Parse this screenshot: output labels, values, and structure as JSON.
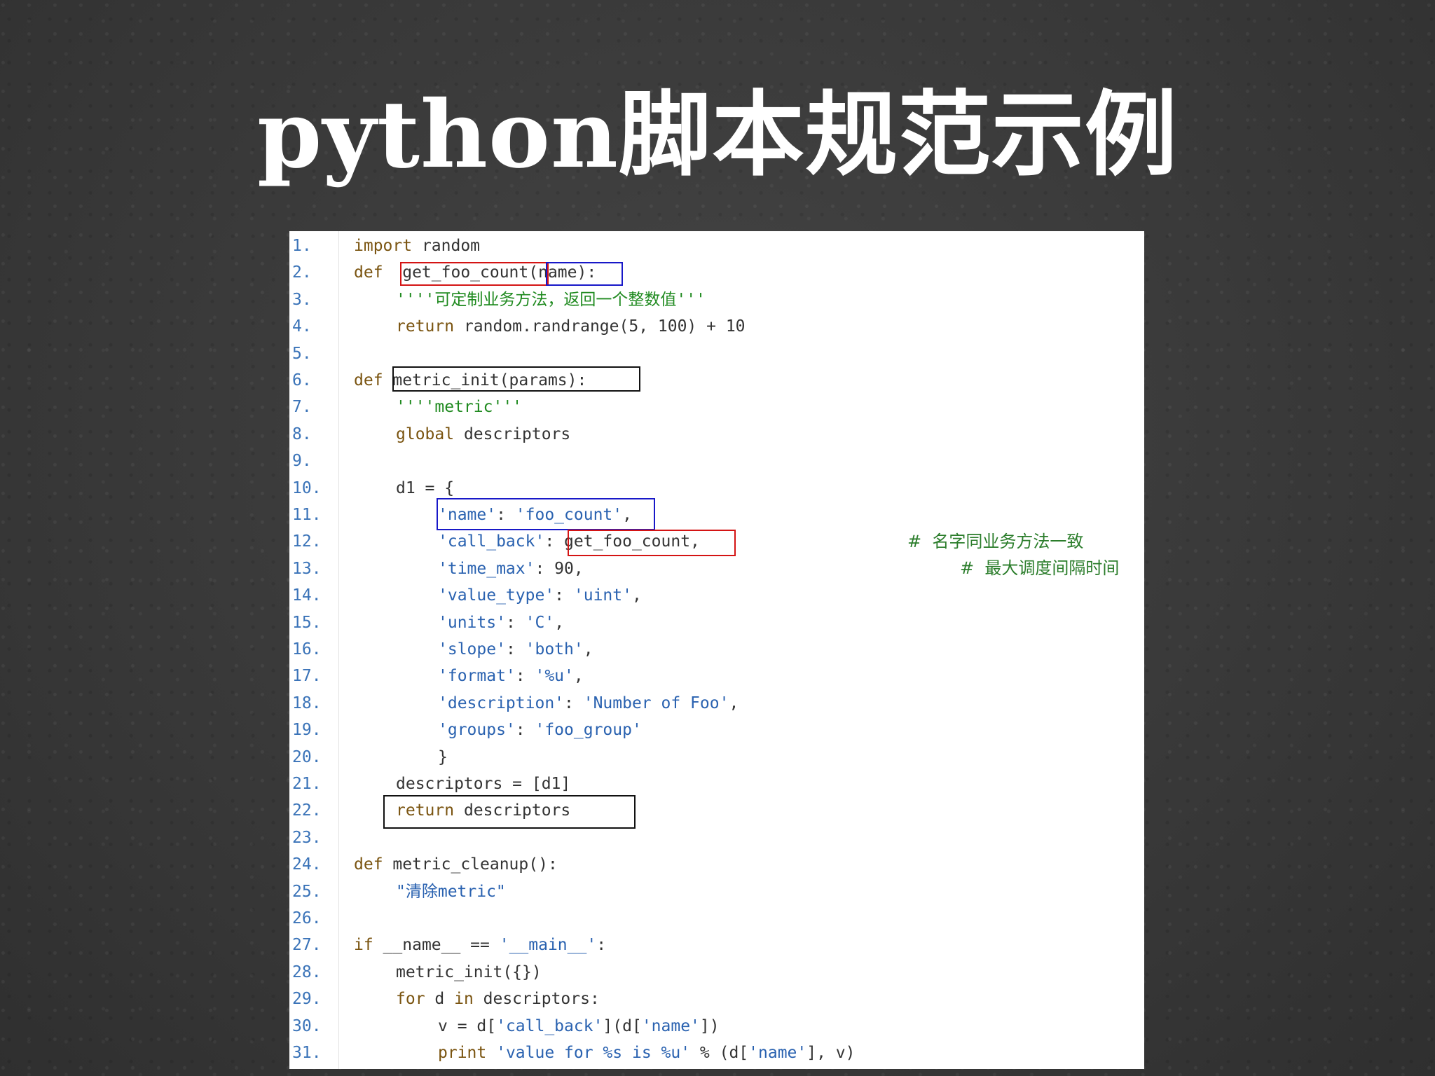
{
  "slide": {
    "title": "python脚本规范示例"
  },
  "code": {
    "lines": [
      {
        "n": "1.",
        "indent": 0,
        "tokens": [
          {
            "t": "import",
            "c": "kw"
          },
          {
            "t": " random",
            "c": "plain"
          }
        ]
      },
      {
        "n": "2.",
        "indent": 0,
        "tokens": [
          {
            "t": "def",
            "c": "kw"
          },
          {
            "t": "  get_foo_count(name):",
            "c": "plain"
          }
        ]
      },
      {
        "n": "3.",
        "indent": 1,
        "tokens": [
          {
            "t": "''''可定制业务方法，返回一个整数值'''",
            "c": "doc"
          }
        ]
      },
      {
        "n": "4.",
        "indent": 1,
        "tokens": [
          {
            "t": "return",
            "c": "kw"
          },
          {
            "t": " random.randrange(5, 100) + 10",
            "c": "plain"
          }
        ]
      },
      {
        "n": "5.",
        "indent": 0,
        "tokens": []
      },
      {
        "n": "6.",
        "indent": 0,
        "tokens": [
          {
            "t": "def",
            "c": "kw"
          },
          {
            "t": " metric_init(params):",
            "c": "plain"
          }
        ]
      },
      {
        "n": "7.",
        "indent": 1,
        "tokens": [
          {
            "t": "''''metric'''",
            "c": "doc"
          }
        ]
      },
      {
        "n": "8.",
        "indent": 1,
        "tokens": [
          {
            "t": "global",
            "c": "kw"
          },
          {
            "t": " descriptors",
            "c": "plain"
          }
        ]
      },
      {
        "n": "9.",
        "indent": 0,
        "tokens": []
      },
      {
        "n": "10.",
        "indent": 1,
        "tokens": [
          {
            "t": "d1 = {",
            "c": "plain"
          }
        ]
      },
      {
        "n": "11.",
        "indent": 2,
        "tokens": [
          {
            "t": "'name'",
            "c": "str"
          },
          {
            "t": ": ",
            "c": "plain"
          },
          {
            "t": "'foo_count'",
            "c": "str"
          },
          {
            "t": ",",
            "c": "plain"
          }
        ]
      },
      {
        "n": "12.",
        "indent": 2,
        "tokens": [
          {
            "t": "'call_back'",
            "c": "str"
          },
          {
            "t": ": get_foo_count,",
            "c": "plain"
          }
        ]
      },
      {
        "n": "13.",
        "indent": 2,
        "tokens": [
          {
            "t": "'time_max'",
            "c": "str"
          },
          {
            "t": ": 90,",
            "c": "plain"
          }
        ]
      },
      {
        "n": "14.",
        "indent": 2,
        "tokens": [
          {
            "t": "'value_type'",
            "c": "str"
          },
          {
            "t": ": ",
            "c": "plain"
          },
          {
            "t": "'uint'",
            "c": "str"
          },
          {
            "t": ",",
            "c": "plain"
          }
        ]
      },
      {
        "n": "15.",
        "indent": 2,
        "tokens": [
          {
            "t": "'units'",
            "c": "str"
          },
          {
            "t": ": ",
            "c": "plain"
          },
          {
            "t": "'C'",
            "c": "str"
          },
          {
            "t": ",",
            "c": "plain"
          }
        ]
      },
      {
        "n": "16.",
        "indent": 2,
        "tokens": [
          {
            "t": "'slope'",
            "c": "str"
          },
          {
            "t": ": ",
            "c": "plain"
          },
          {
            "t": "'both'",
            "c": "str"
          },
          {
            "t": ",",
            "c": "plain"
          }
        ]
      },
      {
        "n": "17.",
        "indent": 2,
        "tokens": [
          {
            "t": "'format'",
            "c": "str"
          },
          {
            "t": ": ",
            "c": "plain"
          },
          {
            "t": "'%u'",
            "c": "str"
          },
          {
            "t": ",",
            "c": "plain"
          }
        ]
      },
      {
        "n": "18.",
        "indent": 2,
        "tokens": [
          {
            "t": "'description'",
            "c": "str"
          },
          {
            "t": ": ",
            "c": "plain"
          },
          {
            "t": "'Number of Foo'",
            "c": "str"
          },
          {
            "t": ",",
            "c": "plain"
          }
        ]
      },
      {
        "n": "19.",
        "indent": 2,
        "tokens": [
          {
            "t": "'groups'",
            "c": "str"
          },
          {
            "t": ": ",
            "c": "plain"
          },
          {
            "t": "'foo_group'",
            "c": "str"
          }
        ]
      },
      {
        "n": "20.",
        "indent": 2,
        "tokens": [
          {
            "t": "}",
            "c": "plain"
          }
        ]
      },
      {
        "n": "21.",
        "indent": 1,
        "tokens": [
          {
            "t": "descriptors = [d1]",
            "c": "plain"
          }
        ]
      },
      {
        "n": "22.",
        "indent": 1,
        "tokens": [
          {
            "t": "return",
            "c": "kw"
          },
          {
            "t": " descriptors",
            "c": "plain"
          }
        ]
      },
      {
        "n": "23.",
        "indent": 0,
        "tokens": []
      },
      {
        "n": "24.",
        "indent": 0,
        "tokens": [
          {
            "t": "def",
            "c": "kw"
          },
          {
            "t": " metric_cleanup():",
            "c": "plain"
          }
        ]
      },
      {
        "n": "25.",
        "indent": 1,
        "tokens": [
          {
            "t": "\"清除metric\"",
            "c": "str"
          }
        ]
      },
      {
        "n": "26.",
        "indent": 0,
        "tokens": []
      },
      {
        "n": "27.",
        "indent": 0,
        "tokens": [
          {
            "t": "if",
            "c": "kw"
          },
          {
            "t": " __name__ == ",
            "c": "plain"
          },
          {
            "t": "'__main__'",
            "c": "str"
          },
          {
            "t": ":",
            "c": "plain"
          }
        ]
      },
      {
        "n": "28.",
        "indent": 1,
        "tokens": [
          {
            "t": "metric_init({})",
            "c": "plain"
          }
        ]
      },
      {
        "n": "29.",
        "indent": 1,
        "tokens": [
          {
            "t": "for",
            "c": "kw"
          },
          {
            "t": " d ",
            "c": "plain"
          },
          {
            "t": "in",
            "c": "kw"
          },
          {
            "t": " descriptors:",
            "c": "plain"
          }
        ]
      },
      {
        "n": "30.",
        "indent": 2,
        "tokens": [
          {
            "t": "v = d[",
            "c": "plain"
          },
          {
            "t": "'call_back'",
            "c": "str"
          },
          {
            "t": "](d[",
            "c": "plain"
          },
          {
            "t": "'name'",
            "c": "str"
          },
          {
            "t": "])",
            "c": "plain"
          }
        ]
      },
      {
        "n": "31.",
        "indent": 2,
        "tokens": [
          {
            "t": "print",
            "c": "kw"
          },
          {
            "t": " ",
            "c": "plain"
          },
          {
            "t": "'value for %s is %u'",
            "c": "str"
          },
          {
            "t": " % (d[",
            "c": "plain"
          },
          {
            "t": "'name'",
            "c": "str"
          },
          {
            "t": "], v)",
            "c": "plain"
          }
        ]
      }
    ],
    "comments": {
      "line12": "#  名字同业务方法一致",
      "line13": "#  最大调度间隔时间"
    }
  }
}
